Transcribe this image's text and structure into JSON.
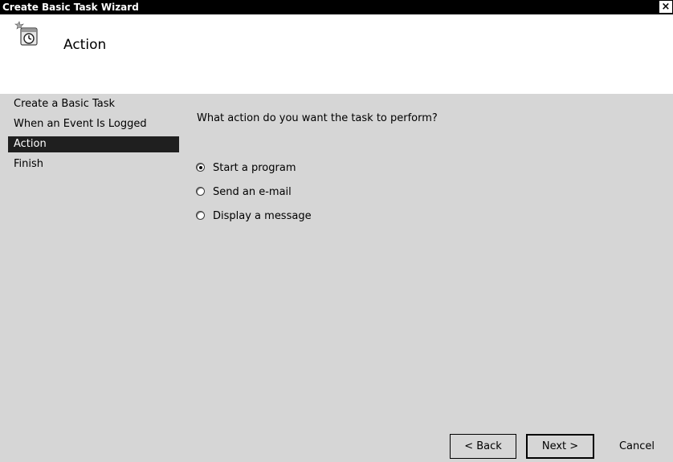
{
  "window": {
    "title": "Create Basic Task Wizard",
    "close_label": "×"
  },
  "header": {
    "title": "Action",
    "icon": "clock-task-icon"
  },
  "steps": [
    {
      "label": "Create a Basic Task",
      "active": false
    },
    {
      "label": "When an Event Is Logged",
      "active": false
    },
    {
      "label": "Action",
      "active": true
    },
    {
      "label": "Finish",
      "active": false
    }
  ],
  "main": {
    "question": "What action do you want the task to perform?",
    "options": [
      {
        "label": "Start a program",
        "selected": true
      },
      {
        "label": "Send an e-mail",
        "selected": false
      },
      {
        "label": "Display a message",
        "selected": false
      }
    ]
  },
  "buttons": {
    "back": "< Back",
    "next": "Next >",
    "cancel": "Cancel"
  }
}
